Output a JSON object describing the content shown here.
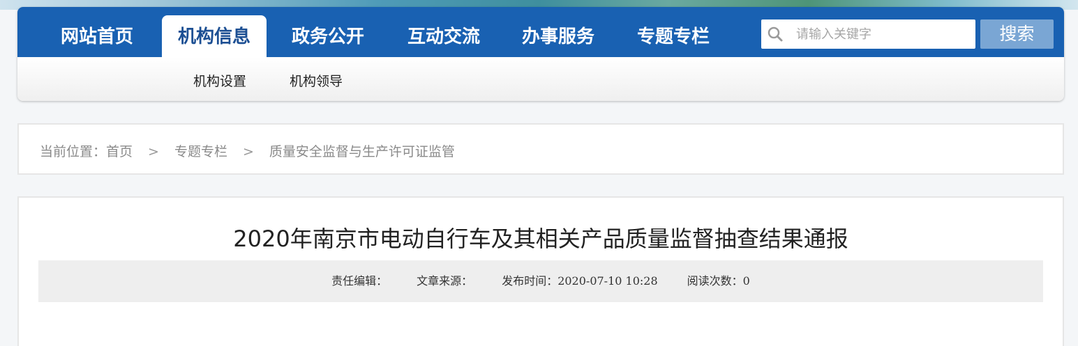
{
  "nav": {
    "items": [
      {
        "label": "网站首页"
      },
      {
        "label": "机构信息"
      },
      {
        "label": "政务公开"
      },
      {
        "label": "互动交流"
      },
      {
        "label": "办事服务"
      },
      {
        "label": "专题专栏"
      }
    ],
    "active_index": 1
  },
  "search": {
    "placeholder": "请输入关键字",
    "value": "",
    "button_label": "搜索",
    "icon": "search-icon"
  },
  "sub_nav": {
    "items": [
      {
        "label": "机构设置"
      },
      {
        "label": "机构领导"
      }
    ]
  },
  "breadcrumb": {
    "prefix": "当前位置：",
    "items": [
      {
        "label": "首页"
      },
      {
        "label": "专题专栏"
      },
      {
        "label": "质量安全监督与生产许可证监管"
      }
    ],
    "separator": ">"
  },
  "article": {
    "title": "2020年南京市电动自行车及其相关产品质量监督抽查结果通报",
    "meta": {
      "editor": "责任编辑：",
      "source": "文章来源：",
      "published": "发布时间：2020-07-10 10:28",
      "reads": "阅读次数：0"
    }
  },
  "colors": {
    "primary": "#1961b2",
    "active_tab_text": "#1c4f93",
    "search_button": "#7aa6d4"
  }
}
